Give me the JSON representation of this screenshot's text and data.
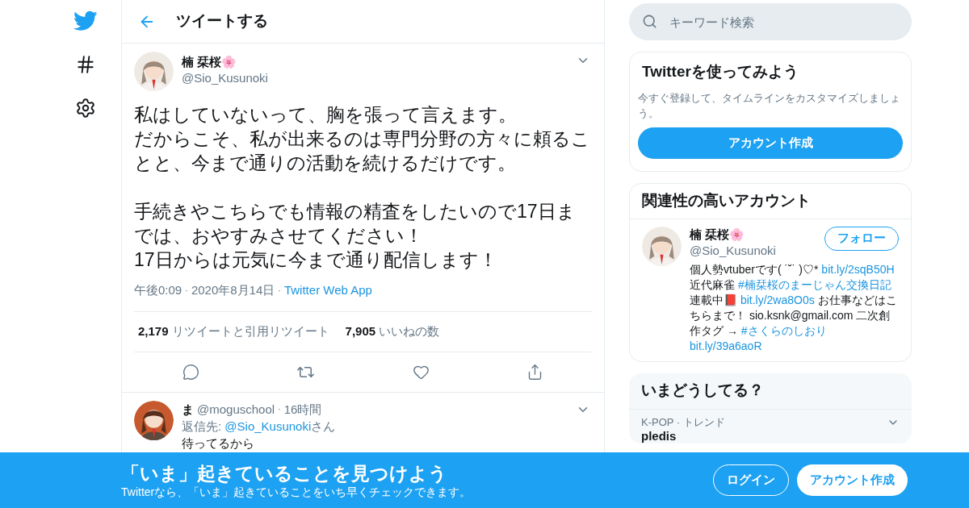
{
  "header": {
    "title": "ツイートする"
  },
  "search": {
    "placeholder": "キーワード検索"
  },
  "tweet": {
    "name": "楠 栞桜🌸",
    "handle": "@Sio_Kusunoki",
    "paragraphs": [
      [
        "私はしていないって、胸を張って言えます。",
        "だからこそ、私が出来るのは専門分野の方々に頼ることと、今まで通りの活動を続けるだけです。"
      ],
      [
        "手続きやこちらでも情報の精査をしたいので17日までは、おやすみさせてください！",
        "17日からは元気に今まで通り配信します！"
      ]
    ],
    "time": "午後0:09",
    "separator": "·",
    "date": "2020年8月14日",
    "source": "Twitter Web App",
    "stats": [
      {
        "count": "2,179",
        "label": "リツイートと引用リツイート"
      },
      {
        "count": "7,905",
        "label": "いいねの数"
      }
    ]
  },
  "reply": {
    "name": "ま",
    "handle": "@moguschool",
    "separator": "·",
    "time": "16時間",
    "reply_prefix": "返信先: ",
    "reply_to": "@Sio_Kusunoki",
    "reply_suffix": "さん",
    "text": "待ってるから"
  },
  "signup_card": {
    "title": "Twitterを使ってみよう",
    "text": "今すぐ登録して、タイムラインをカスタマイズしましょう。",
    "button": "アカウント作成"
  },
  "related": {
    "title": "関連性の高いアカウント",
    "name": "楠 栞桜🌸",
    "handle": "@Sio_Kusunoki",
    "button": "フォロー",
    "bio": [
      {
        "kind": "text",
        "text": "個人勢vtuberです( ˙˘˙ )♡*"
      },
      {
        "kind": "link",
        "text": "bit.ly/2sqB50H"
      },
      {
        "kind": "text",
        "text": "近代麻雀"
      },
      {
        "kind": "link",
        "text": "#楠栞桜のまーじゃん交換日記"
      },
      {
        "kind": "text",
        "text": "連載中📕"
      },
      {
        "kind": "link",
        "text": "bit.ly/2wa8O0s"
      },
      {
        "kind": "text",
        "text": "お仕事などはこちらまで！ sio.ksnk@gmail.com 二次創作タグ →"
      },
      {
        "kind": "link",
        "text": "#さくらのしおり"
      },
      {
        "kind": "link",
        "text": "bit.ly/39a6aoR"
      }
    ]
  },
  "trends": {
    "title": "いまどうしてる？",
    "items": [
      {
        "context": "K-POP · トレンド",
        "name": "pledis"
      }
    ]
  },
  "banner": {
    "title": "「いま」起きていることを見つけよう",
    "text": "Twitterなら、「いま」起きていることをいち早くチェックできます。",
    "login": "ログイン",
    "signup": "アカウント作成"
  }
}
